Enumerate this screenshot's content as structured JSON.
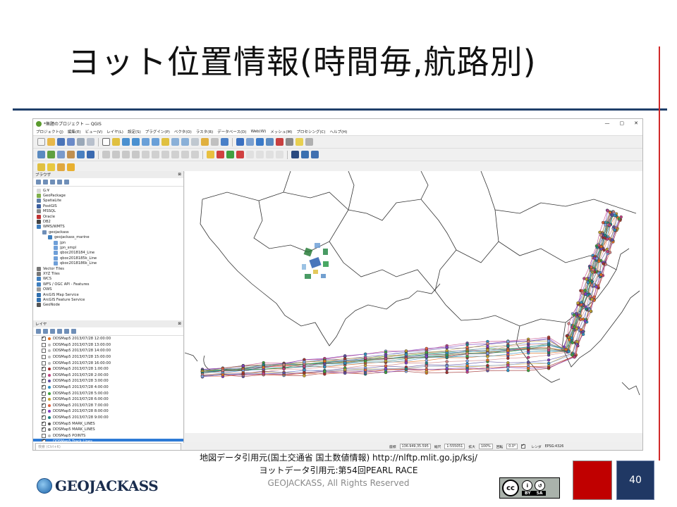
{
  "slide": {
    "title": "ヨット位置情報(時間毎,航路別)",
    "credit_line1": "地図データ引用元(国土交通省 国土数値情報) http://nlftp.mlit.go.jp/ksj/",
    "credit_line2": "ヨットデータ引用元:第54回PEARL RACE",
    "brand": "GEOJACKASS",
    "rights": "GEOJACKASS, All Rights Reserved",
    "page_number": "40",
    "license": {
      "by": "BY",
      "sa": "SA",
      "cc": "cc"
    }
  },
  "qgis": {
    "window_title": "*無題のプロジェクト — QGIS",
    "window_controls": [
      "—",
      "▢",
      "✕"
    ],
    "menu": [
      "プロジェクト(J)",
      "編集(E)",
      "ビュー(V)",
      "レイヤ(L)",
      "設定(S)",
      "プラグイン(P)",
      "ベクタ(O)",
      "ラスタ(R)",
      "データベース(D)",
      "Web(W)",
      "メッシュ(M)",
      "プロセシング(C)",
      "ヘルプ(H)"
    ],
    "browser_panel_title": "ブラウザ",
    "browser_items": [
      {
        "label": "G:¥",
        "indent": 0,
        "color": "#d9d9d9"
      },
      {
        "label": "GeoPackage",
        "indent": 0,
        "color": "#7fb04a"
      },
      {
        "label": "SpatiaLite",
        "indent": 0,
        "color": "#5f7fa8"
      },
      {
        "label": "PostGIS",
        "indent": 0,
        "color": "#3b5fa0"
      },
      {
        "label": "MSSQL",
        "indent": 0,
        "color": "#888888"
      },
      {
        "label": "Oracle",
        "indent": 0,
        "color": "#c03030"
      },
      {
        "label": "DB2",
        "indent": 0,
        "color": "#444444"
      },
      {
        "label": "WMS/WMTS",
        "indent": 0,
        "color": "#3f7fbf"
      },
      {
        "label": "geojackass",
        "indent": 1,
        "color": "#6f8fb8"
      },
      {
        "label": "geojackass_marine",
        "indent": 2,
        "color": "#3f7fbf"
      },
      {
        "label": "jpn",
        "indent": 3,
        "color": "#6f9fd8"
      },
      {
        "label": "jpn_smpl",
        "indent": 3,
        "color": "#6f9fd8"
      },
      {
        "label": "qboc2018184_Line",
        "indent": 3,
        "color": "#6f9fd8"
      },
      {
        "label": "qboc2018185k_Line",
        "indent": 3,
        "color": "#6f9fd8"
      },
      {
        "label": "qboc2018186k_Line",
        "indent": 3,
        "color": "#6f9fd8"
      },
      {
        "label": "Vector Tiles",
        "indent": 0,
        "color": "#777777"
      },
      {
        "label": "XYZ Tiles",
        "indent": 0,
        "color": "#777777"
      },
      {
        "label": "WCS",
        "indent": 0,
        "color": "#3f7fbf"
      },
      {
        "label": "WFS / OGC API - Features",
        "indent": 0,
        "color": "#3f7fbf"
      },
      {
        "label": "OWS",
        "indent": 0,
        "color": "#999999"
      },
      {
        "label": "ArcGIS Map Service",
        "indent": 0,
        "color": "#2f6faf"
      },
      {
        "label": "ArcGIS Feature Service",
        "indent": 0,
        "color": "#2f6faf"
      },
      {
        "label": "GeoNode",
        "indent": 0,
        "color": "#555555"
      }
    ],
    "layers_panel_title": "レイヤ",
    "layers": [
      {
        "label": "DDSMap5 2013/07/28 12:00:00",
        "checked": true,
        "dot": "#e07020"
      },
      {
        "label": "DDSMap5 2013/07/28 13:00:00",
        "checked": false,
        "dot": "#bbbbbb"
      },
      {
        "label": "DDSMap5 2013/07/28 14:00:00",
        "checked": false,
        "dot": "#bbbbbb"
      },
      {
        "label": "DDSMap5 2013/07/28 15:00:00",
        "checked": false,
        "dot": "#bbbbbb"
      },
      {
        "label": "DDSMap5 2013/07/28 16:00:00",
        "checked": false,
        "dot": "#bbbbbb"
      },
      {
        "label": "DDSMap5 2013/07/28 1:00:00",
        "checked": true,
        "dot": "#a03030"
      },
      {
        "label": "DDSMap5 2013/07/28 2:00:00",
        "checked": true,
        "dot": "#c04080"
      },
      {
        "label": "DDSMap5 2013/07/28 3:00:00",
        "checked": true,
        "dot": "#6050a0"
      },
      {
        "label": "DDSMap5 2013/07/28 4:00:00",
        "checked": true,
        "dot": "#3090c0"
      },
      {
        "label": "DDSMap5 2013/07/28 5:00:00",
        "checked": true,
        "dot": "#40a040"
      },
      {
        "label": "DDSMap5 2013/07/28 6:00:00",
        "checked": true,
        "dot": "#c0a030"
      },
      {
        "label": "DDSMap5 2013/07/28 7:00:00",
        "checked": true,
        "dot": "#e06040"
      },
      {
        "label": "DDSMap5 2013/07/28 8:00:00",
        "checked": true,
        "dot": "#8040c0"
      },
      {
        "label": "DDSMap5 2013/07/28 9:00:00",
        "checked": true,
        "dot": "#208080"
      },
      {
        "label": "DDSMap5 MARK_LINES",
        "checked": true,
        "dot": "#555555"
      },
      {
        "label": "DDSMap5 MARK_LINES",
        "checked": true,
        "dot": "#777777"
      },
      {
        "label": "DDSMap5 POINTS",
        "checked": false,
        "dot": "#bbbbbb"
      },
      {
        "label": "DDSMap5 Track Lines",
        "checked": true,
        "dot": "#2e7bd6",
        "selected": true
      }
    ],
    "search_placeholder": "検索 (Ctrl+K)",
    "status": {
      "coord_label": "座標",
      "coord_value": "136.949,35.595",
      "scale_label": "縮尺",
      "scale_value": "1:555051",
      "magnifier_label": "拡大",
      "magnifier_value": "100%",
      "rotation_label": "回転",
      "rotation_value": "0.0°",
      "render_label": "レンダ",
      "crs": "EPSG:4326"
    }
  },
  "colors": {
    "title_rule": "#1f3f6a",
    "accent_red": "#c00000",
    "page_box": "#203864"
  }
}
